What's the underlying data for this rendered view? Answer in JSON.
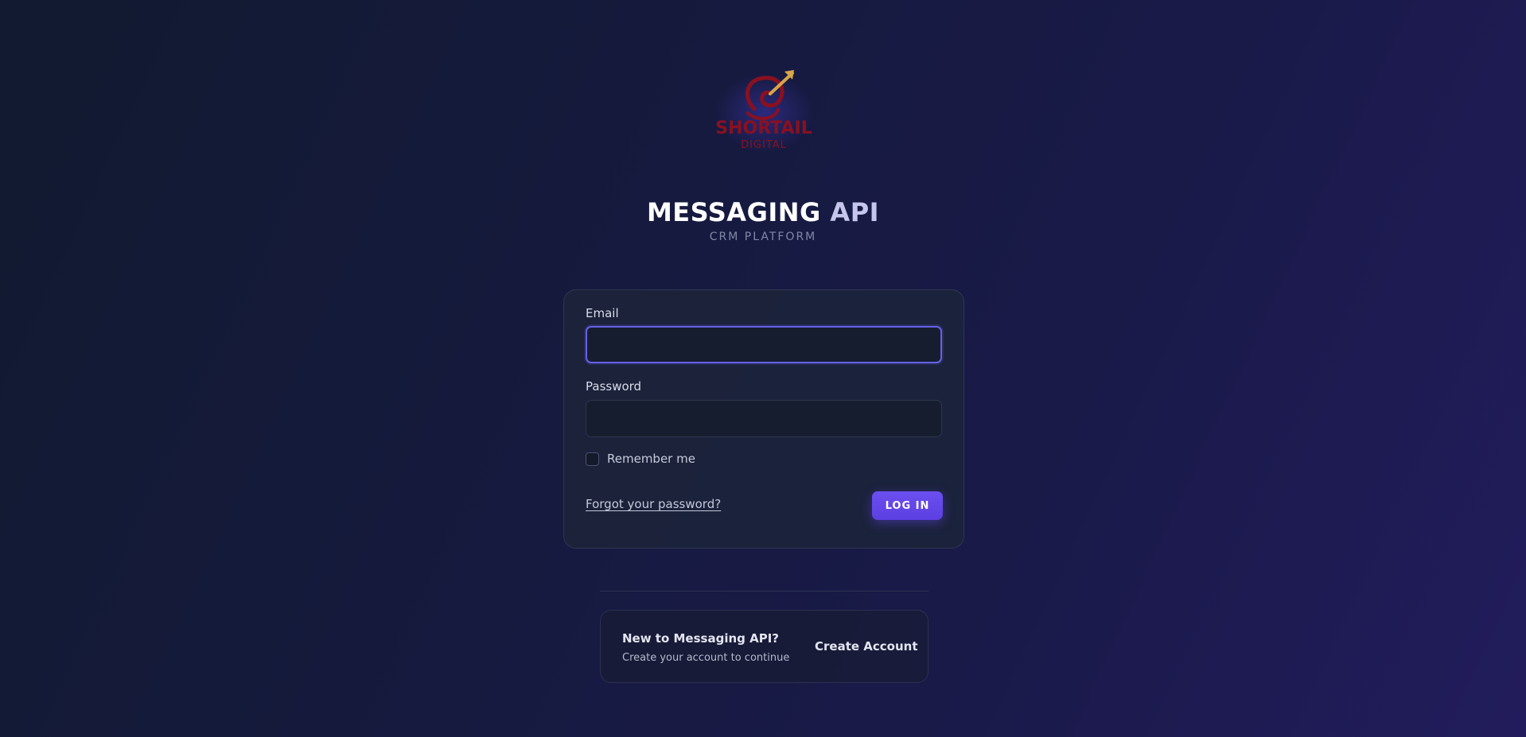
{
  "brand": {
    "logo_icon": "shortail-digital-logo",
    "logo_name": "SHORTAIL",
    "logo_tagline": "DIGITAL",
    "title_main": "MESSAGING",
    "title_accent": "API",
    "subtitle": "CRM PLATFORM"
  },
  "login_form": {
    "email_label": "Email",
    "email_value": "",
    "password_label": "Password",
    "password_value": "",
    "remember_label": "Remember me",
    "remember_checked": false,
    "forgot_link": "Forgot your password?",
    "submit_label": "LOG IN"
  },
  "signup": {
    "title": "New to Messaging API?",
    "subtitle": "Create your account to continue",
    "link": "Create Account"
  },
  "colors": {
    "accent": "#6b4ff0",
    "focus_ring": "#6660e8",
    "logo_red": "#8a1020",
    "logo_gold": "#d7a64a"
  }
}
